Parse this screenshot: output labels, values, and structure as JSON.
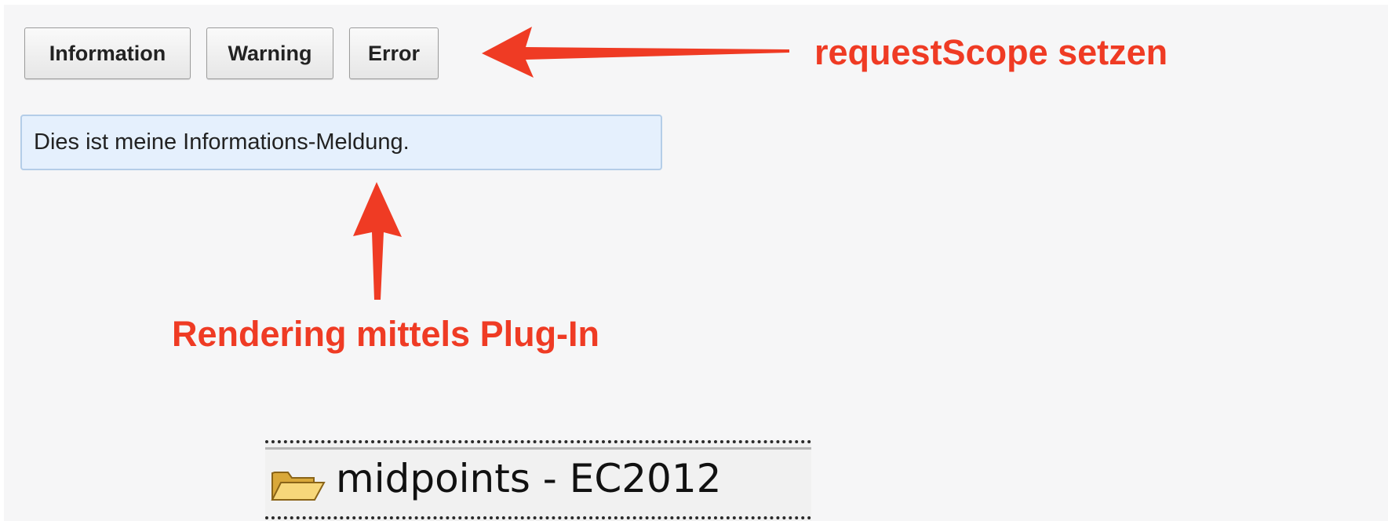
{
  "toolbar": {
    "buttons": [
      {
        "label": "Information"
      },
      {
        "label": "Warning"
      },
      {
        "label": "Error"
      }
    ]
  },
  "message": {
    "text": "Dies ist meine Informations-Meldung.",
    "background": "#e5f0fd",
    "border": "#b4cde8"
  },
  "annotations": {
    "request_scope": "requestScope setzen",
    "rendering": "Rendering mittels Plug-In",
    "color": "#ef3b24"
  },
  "project": {
    "name": "midpoints - EC2012",
    "icon": "open-folder-icon"
  }
}
